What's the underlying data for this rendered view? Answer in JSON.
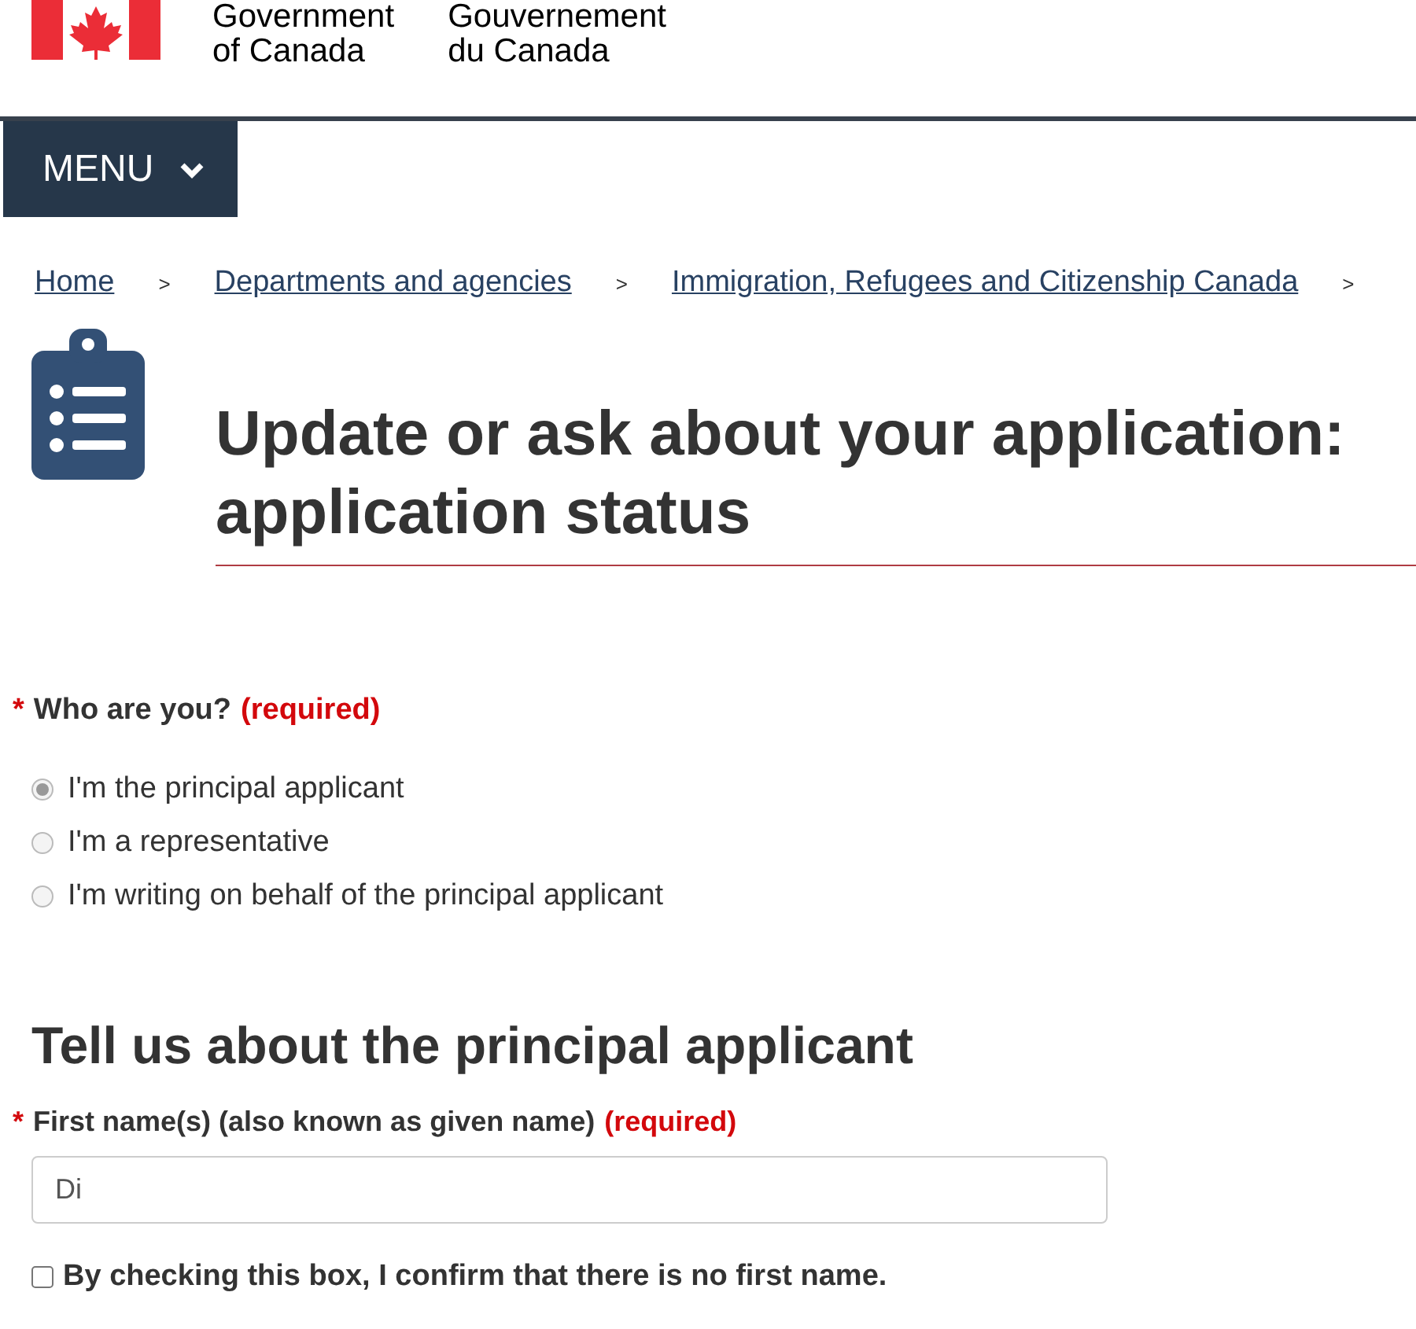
{
  "header": {
    "signature_en": [
      "Government",
      "of Canada"
    ],
    "signature_fr": [
      "Gouvernement",
      "du Canada"
    ]
  },
  "menu": {
    "label": "MENU"
  },
  "breadcrumbs": [
    {
      "label": "Home"
    },
    {
      "label": "Departments and agencies"
    },
    {
      "label": "Immigration, Refugees and Citizenship Canada"
    }
  ],
  "breadcrumb_separator": ">",
  "page_title": "Update or ask about your application: application status",
  "question": {
    "marker": "*",
    "label": "Who are you?",
    "required": "(required)",
    "options": [
      {
        "label": "I'm the principal applicant",
        "selected": true
      },
      {
        "label": "I'm a representative",
        "selected": false
      },
      {
        "label": "I'm writing on behalf of the principal applicant",
        "selected": false
      }
    ]
  },
  "section_title": "Tell us about the principal applicant",
  "first_name": {
    "marker": "*",
    "label": "First name(s) (also known as given name)",
    "required": "(required)",
    "value": "Di"
  },
  "no_first_name": {
    "label": "By checking this box, I confirm that there is no first name.",
    "checked": false
  }
}
